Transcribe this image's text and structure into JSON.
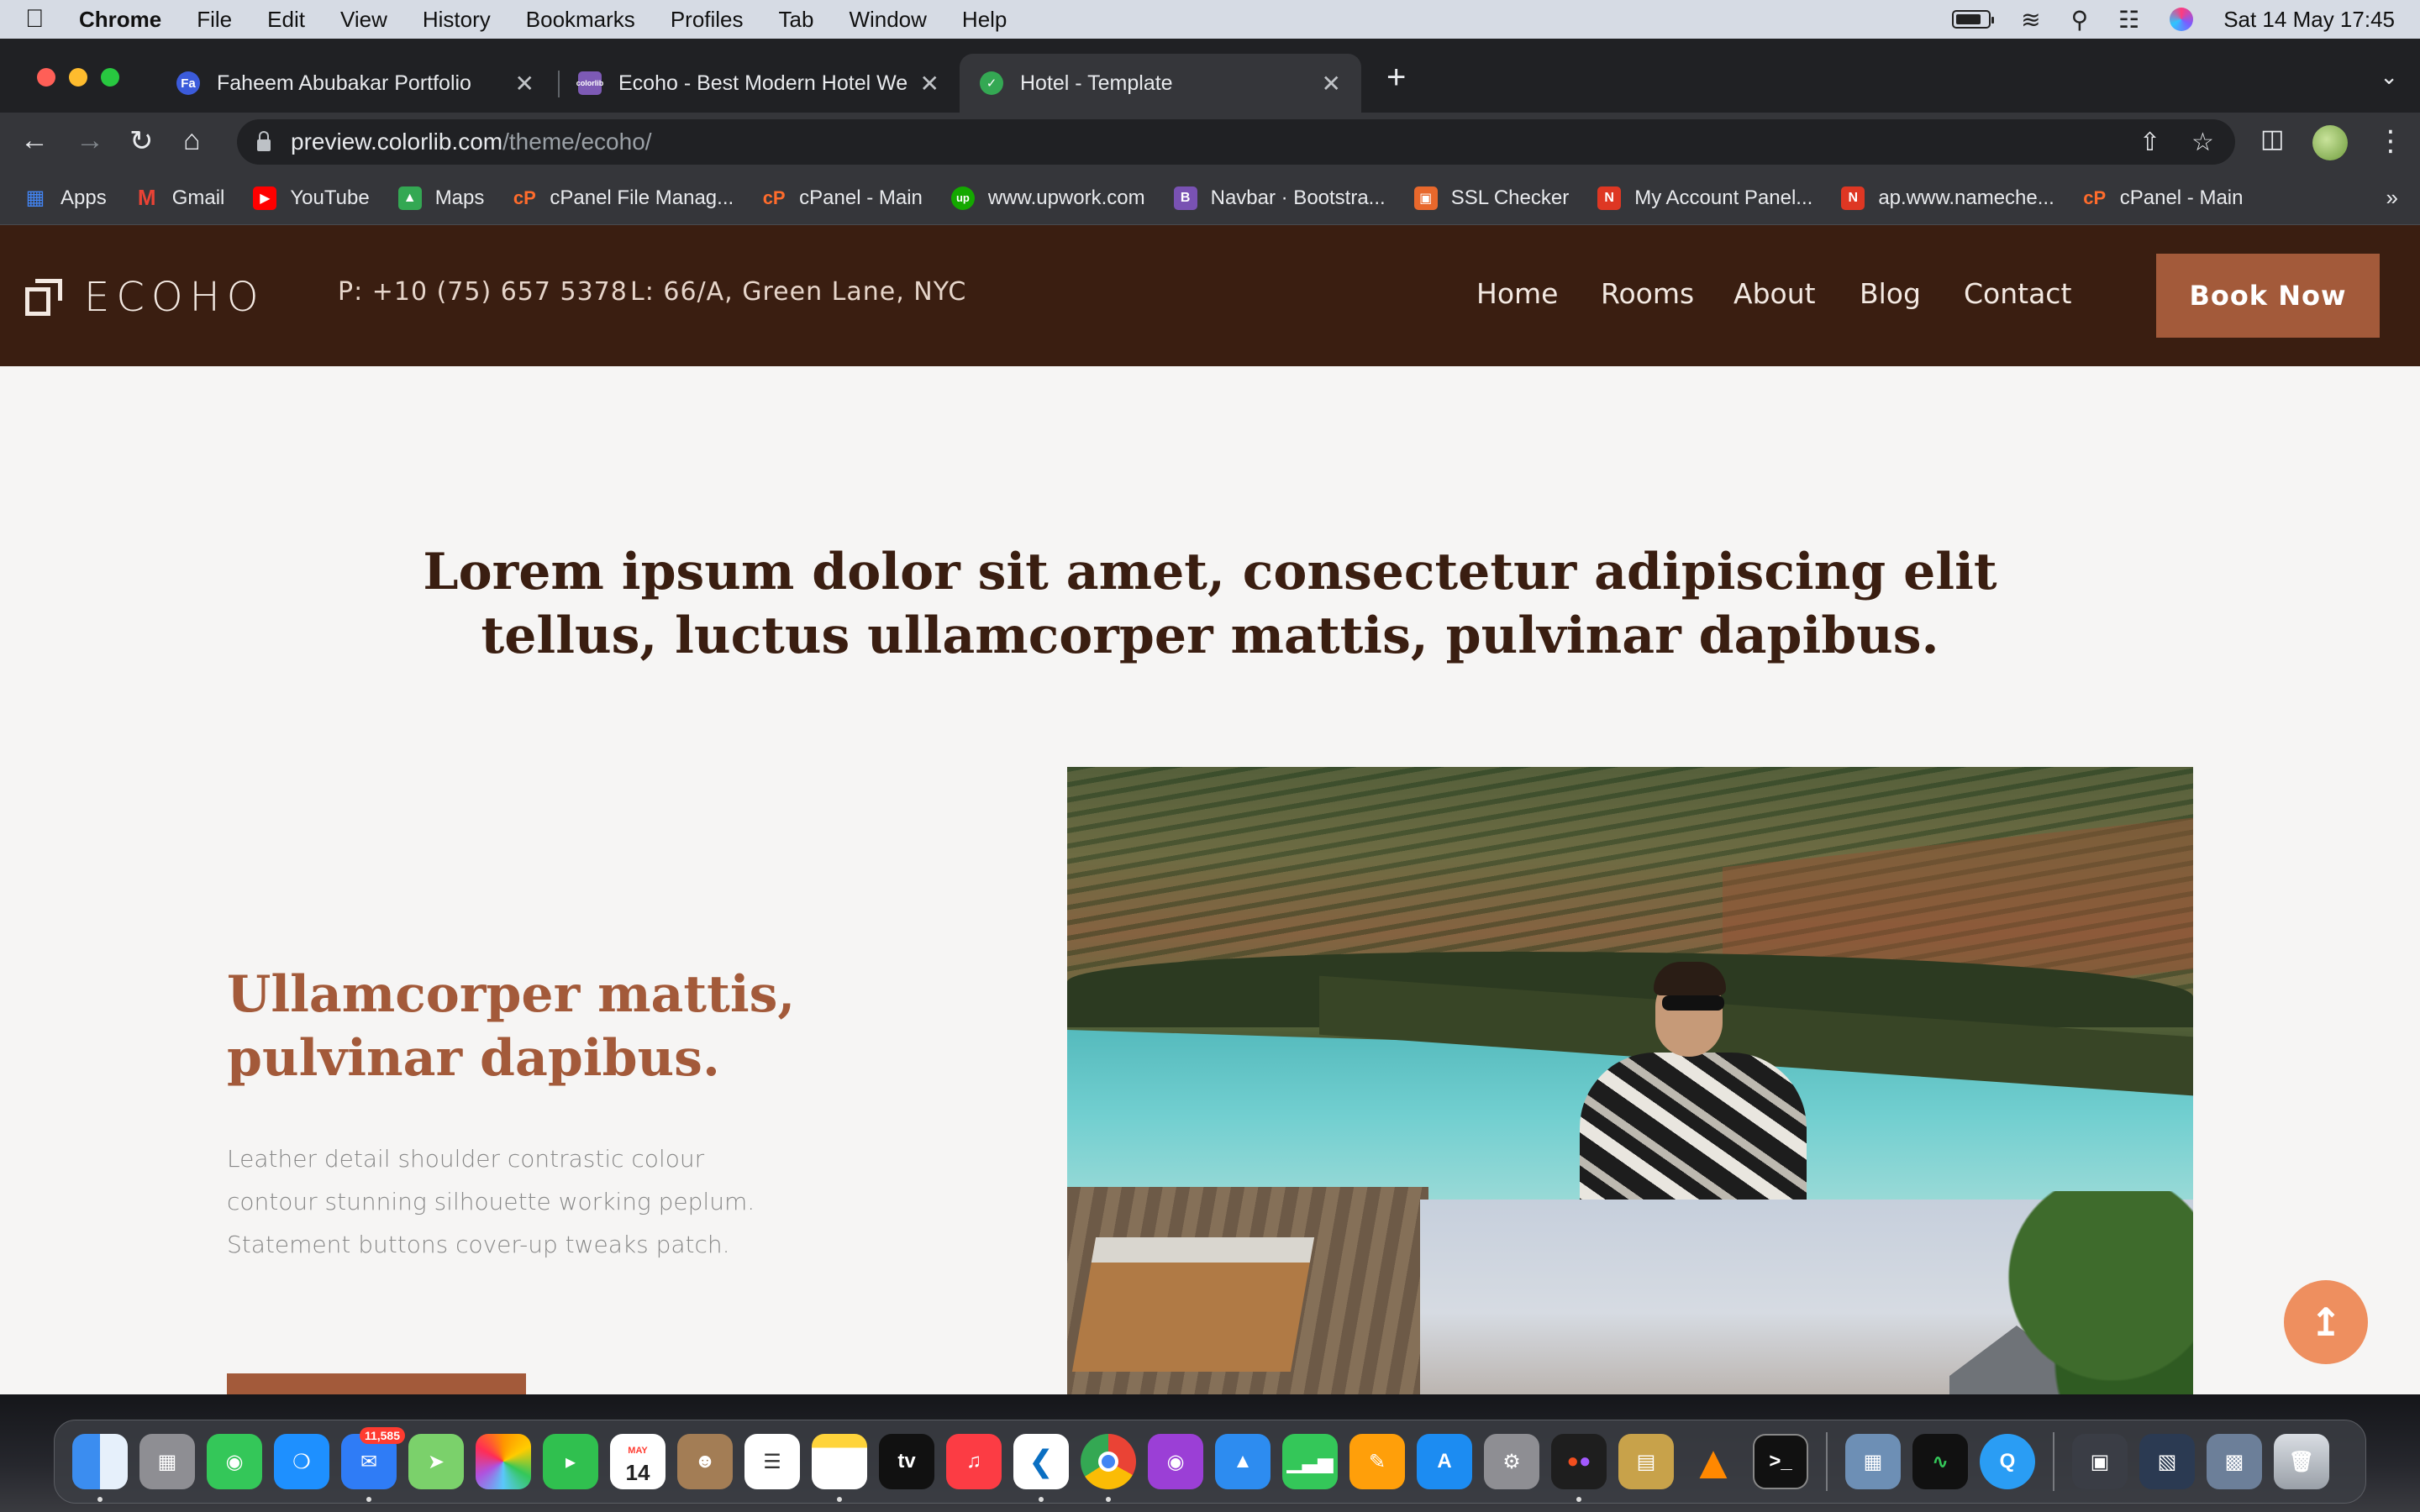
{
  "menubar": {
    "app": "Chrome",
    "items": [
      "File",
      "Edit",
      "View",
      "History",
      "Bookmarks",
      "Profiles",
      "Tab",
      "Window",
      "Help"
    ],
    "date_time": "Sat 14 May  17:45"
  },
  "tabs": [
    {
      "title": "Faheem Abubakar Portfolio",
      "favicon": "Fa",
      "color": "#3b5bdb"
    },
    {
      "title": "Ecoho - Best Modern Hotel We",
      "favicon": "colorlib",
      "color": "#7d5ab5"
    },
    {
      "title": "Hotel - Template",
      "favicon": "check",
      "color": "#34a853"
    }
  ],
  "address": {
    "host": "preview.colorlib.com",
    "path": "/theme/ecoho/"
  },
  "bookmarks": [
    {
      "label": "Apps",
      "icon": "apps-grid-icon",
      "color": "#4285f4"
    },
    {
      "label": "Gmail",
      "icon": "gmail-icon",
      "color": "#ea4335"
    },
    {
      "label": "YouTube",
      "icon": "youtube-icon",
      "color": "#ff0000"
    },
    {
      "label": "Maps",
      "icon": "maps-icon",
      "color": "#34a853"
    },
    {
      "label": "cPanel File Manag...",
      "icon": "cpanel-icon",
      "color": "#ff6c2c"
    },
    {
      "label": "cPanel - Main",
      "icon": "cpanel-icon",
      "color": "#ff6c2c"
    },
    {
      "label": "www.upwork.com",
      "icon": "upwork-icon",
      "color": "#14a800"
    },
    {
      "label": "Navbar · Bootstra...",
      "icon": "bootstrap-icon",
      "color": "#7952b3"
    },
    {
      "label": "SSL Checker",
      "icon": "lock-icon",
      "color": "#e8682c"
    },
    {
      "label": "My Account Panel...",
      "icon": "namecheap-icon",
      "color": "#de3723"
    },
    {
      "label": "ap.www.nameche...",
      "icon": "namecheap-icon",
      "color": "#de3723"
    },
    {
      "label": "cPanel - Main",
      "icon": "cpanel-icon",
      "color": "#ff6c2c"
    }
  ],
  "site": {
    "logo": "ECOHO",
    "phone": "P: +10 (75) 657 5378",
    "location": "L: 66/A, Green Lane, NYC",
    "nav": [
      "Home",
      "Rooms",
      "About",
      "Blog",
      "Contact"
    ],
    "cta": "Book Now",
    "headline": "Lorem ipsum dolor sit amet, consectetur adipiscing elit tellus, luctus ullamcorper mattis, pulvinar dapibus.",
    "feature_title": "Ullamcorper mattis, pulvinar dapibus.",
    "feature_text": "Leather detail shoulder contrastic colour contour stunning silhouette working peplum. Statement buttons cover-up tweaks patch.",
    "colors": {
      "header_bg": "#3a1e11",
      "accent": "#a35a3a",
      "scroll_button": "#ee8f5f"
    }
  },
  "dock": {
    "mail_badge": "11,585",
    "calendar_month": "MAY",
    "calendar_day": "14",
    "apps": [
      "finder",
      "launchpad",
      "messages",
      "safari",
      "mail",
      "maps",
      "photos",
      "facetime",
      "calendar",
      "contacts",
      "reminders",
      "notes",
      "tv",
      "music",
      "vscode",
      "chrome",
      "podcasts",
      "keynote",
      "numbers",
      "pages",
      "app-store",
      "system-preferences",
      "figma",
      "archive-utility",
      "vlc",
      "terminal",
      "preview",
      "activity-monitor",
      "quicktime",
      "screenshot",
      "window-stack",
      "image-capture",
      "trash"
    ]
  }
}
